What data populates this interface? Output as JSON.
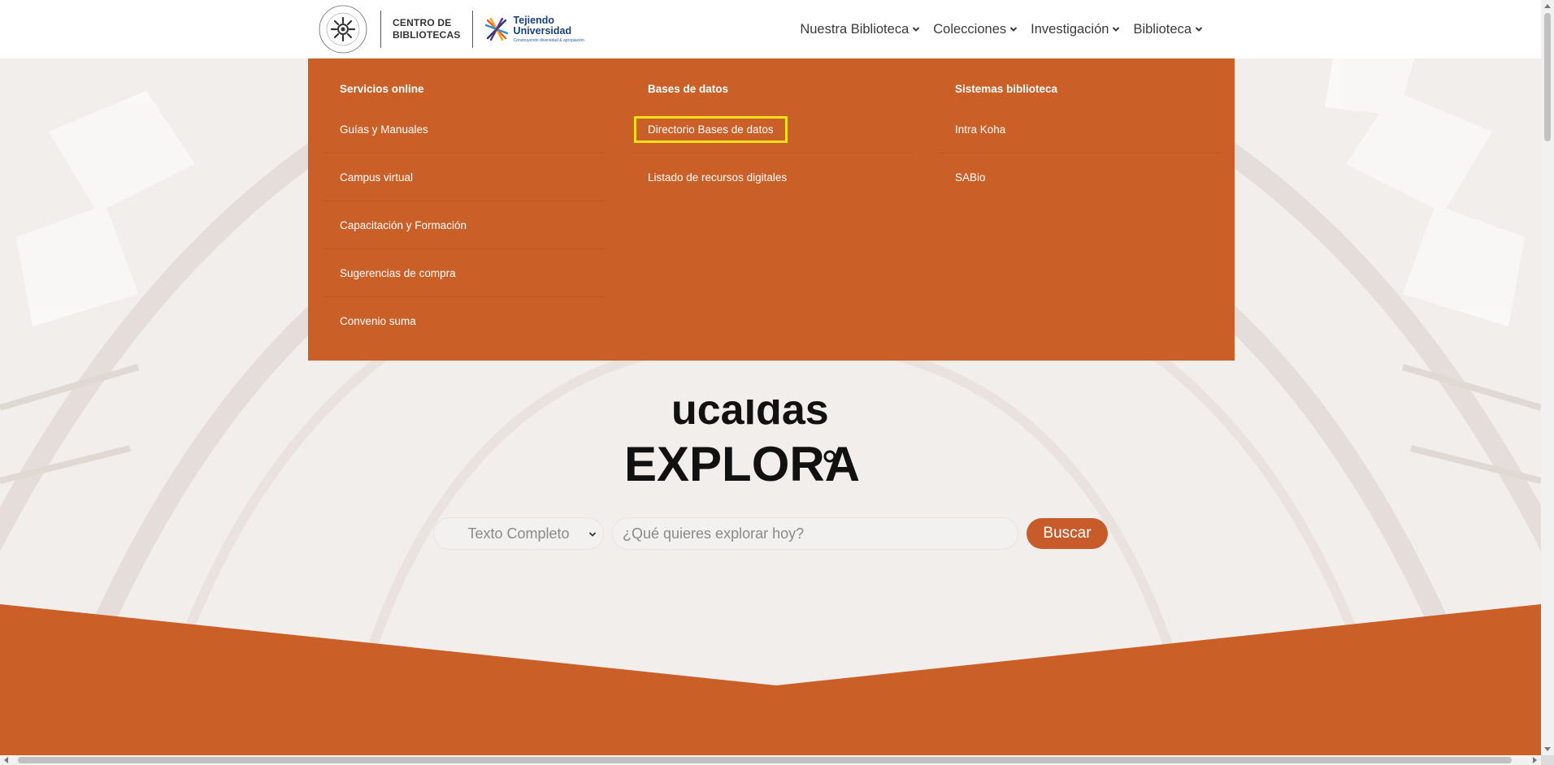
{
  "header": {
    "logo_text_line1": "CENTRO DE",
    "logo_text_line2": "BIBLIOTECAS",
    "tejiendo_line1": "Tejiendo",
    "tejiendo_line2": "Universidad",
    "tejiendo_tagline": "Construyendo diversidad & apropiación",
    "nav": [
      {
        "label": "Nuestra Biblioteca"
      },
      {
        "label": "Colecciones"
      },
      {
        "label": "Investigación"
      },
      {
        "label": "Biblioteca"
      }
    ]
  },
  "mega_menu": {
    "columns": [
      {
        "title": "Servicios online",
        "items": [
          "Guías y Manuales",
          "Campus virtual",
          "Capacitación y Formación",
          "Sugerencias de compra",
          "Convenio suma"
        ]
      },
      {
        "title": "Bases de datos",
        "items": [
          "Directorio Bases de datos",
          "Listado de recursos digitales"
        ]
      },
      {
        "title": "Sistemas biblioteca",
        "items": [
          "Intra Koha",
          "SABio"
        ]
      }
    ],
    "highlighted_item": "Directorio Bases de datos"
  },
  "hero": {
    "brand_word": "EXPLORA",
    "search": {
      "select_value": "Texto Completo",
      "placeholder": "¿Qué quieres explorar hoy?",
      "button_label": "Buscar"
    }
  },
  "colors": {
    "accent": "#cb5f28",
    "highlight": "#f4df1c",
    "text": "#3a3a3a"
  }
}
